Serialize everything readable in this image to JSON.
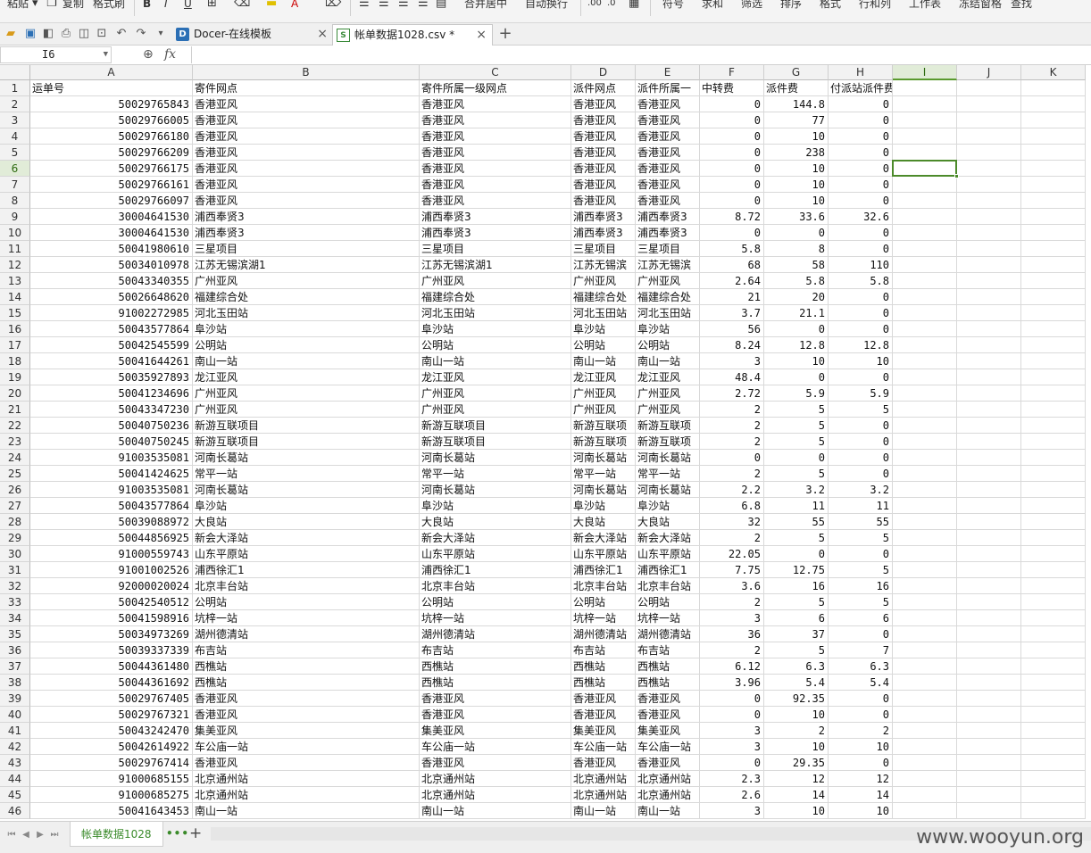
{
  "ribbon": {
    "paste": "粘贴",
    "copy": "复制",
    "format_painter": "格式刷",
    "merge_center": "合并居中",
    "auto_wrap": "自动换行",
    "symbol": "符号",
    "sum": "求和",
    "filter": "筛选",
    "sort": "排序",
    "format": "格式",
    "row_col": "行和列",
    "worksheet": "工作表",
    "freeze": "冻结窗格",
    "find": "查找"
  },
  "tabs": {
    "docer": "Docer-在线模板",
    "docer_icon": "D",
    "csv": "帐单数据1028.csv *",
    "csv_icon": "S"
  },
  "formula": {
    "cell_ref": "I6",
    "fx": "fx",
    "value": ""
  },
  "sheet": {
    "tab": "帐单数据1028",
    "more": "•••",
    "add": "+"
  },
  "watermark": "www.wooyun.org",
  "grid": {
    "columns": [
      "A",
      "B",
      "C",
      "D",
      "E",
      "F",
      "G",
      "H",
      "I",
      "J",
      "K"
    ],
    "selected_column": "I",
    "selected_row": 6,
    "header_row": [
      "运单号",
      "寄件网点",
      "寄件所属一级网点",
      "派件网点",
      "派件所属一",
      "中转费",
      "派件费",
      "付派站派件费"
    ],
    "rows": [
      [
        "50029765843",
        "香港亚风",
        "香港亚风",
        "香港亚风",
        "香港亚风",
        "0",
        "144.8",
        "0"
      ],
      [
        "50029766005",
        "香港亚风",
        "香港亚风",
        "香港亚风",
        "香港亚风",
        "0",
        "77",
        "0"
      ],
      [
        "50029766180",
        "香港亚风",
        "香港亚风",
        "香港亚风",
        "香港亚风",
        "0",
        "10",
        "0"
      ],
      [
        "50029766209",
        "香港亚风",
        "香港亚风",
        "香港亚风",
        "香港亚风",
        "0",
        "238",
        "0"
      ],
      [
        "50029766175",
        "香港亚风",
        "香港亚风",
        "香港亚风",
        "香港亚风",
        "0",
        "10",
        "0"
      ],
      [
        "50029766161",
        "香港亚风",
        "香港亚风",
        "香港亚风",
        "香港亚风",
        "0",
        "10",
        "0"
      ],
      [
        "50029766097",
        "香港亚风",
        "香港亚风",
        "香港亚风",
        "香港亚风",
        "0",
        "10",
        "0"
      ],
      [
        "30004641530",
        "浦西奉贤3",
        "浦西奉贤3",
        "浦西奉贤3",
        "浦西奉贤3",
        "8.72",
        "33.6",
        "32.6"
      ],
      [
        "30004641530",
        "浦西奉贤3",
        "浦西奉贤3",
        "浦西奉贤3",
        "浦西奉贤3",
        "0",
        "0",
        "0"
      ],
      [
        "50041980610",
        "三星项目",
        "三星项目",
        "三星项目",
        "三星项目",
        "5.8",
        "8",
        "0"
      ],
      [
        "50034010978",
        "江苏无锡滨湖1",
        "江苏无锡滨湖1",
        "江苏无锡滨",
        "江苏无锡滨",
        "68",
        "58",
        "110"
      ],
      [
        "50043340355",
        "广州亚风",
        "广州亚风",
        "广州亚风",
        "广州亚风",
        "2.64",
        "5.8",
        "5.8"
      ],
      [
        "50026648620",
        "福建综合处",
        "福建综合处",
        "福建综合处",
        "福建综合处",
        "21",
        "20",
        "0"
      ],
      [
        "91002272985",
        "河北玉田站",
        "河北玉田站",
        "河北玉田站",
        "河北玉田站",
        "3.7",
        "21.1",
        "0"
      ],
      [
        "50043577864",
        "阜沙站",
        "阜沙站",
        "阜沙站",
        "阜沙站",
        "56",
        "0",
        "0"
      ],
      [
        "50042545599",
        "公明站",
        "公明站",
        "公明站",
        "公明站",
        "8.24",
        "12.8",
        "12.8"
      ],
      [
        "50041644261",
        "南山一站",
        "南山一站",
        "南山一站",
        "南山一站",
        "3",
        "10",
        "10"
      ],
      [
        "50035927893",
        "龙江亚风",
        "龙江亚风",
        "龙江亚风",
        "龙江亚风",
        "48.4",
        "0",
        "0"
      ],
      [
        "50041234696",
        "广州亚风",
        "广州亚风",
        "广州亚风",
        "广州亚风",
        "2.72",
        "5.9",
        "5.9"
      ],
      [
        "50043347230",
        "广州亚风",
        "广州亚风",
        "广州亚风",
        "广州亚风",
        "2",
        "5",
        "5"
      ],
      [
        "50040750236",
        "新游互联项目",
        "新游互联项目",
        "新游互联项",
        "新游互联项",
        "2",
        "5",
        "0"
      ],
      [
        "50040750245",
        "新游互联项目",
        "新游互联项目",
        "新游互联项",
        "新游互联项",
        "2",
        "5",
        "0"
      ],
      [
        "91003535081",
        "河南长葛站",
        "河南长葛站",
        "河南长葛站",
        "河南长葛站",
        "0",
        "0",
        "0"
      ],
      [
        "50041424625",
        "常平一站",
        "常平一站",
        "常平一站",
        "常平一站",
        "2",
        "5",
        "0"
      ],
      [
        "91003535081",
        "河南长葛站",
        "河南长葛站",
        "河南长葛站",
        "河南长葛站",
        "2.2",
        "3.2",
        "3.2"
      ],
      [
        "50043577864",
        "阜沙站",
        "阜沙站",
        "阜沙站",
        "阜沙站",
        "6.8",
        "11",
        "11"
      ],
      [
        "50039088972",
        "大良站",
        "大良站",
        "大良站",
        "大良站",
        "32",
        "55",
        "55"
      ],
      [
        "50044856925",
        "新会大泽站",
        "新会大泽站",
        "新会大泽站",
        "新会大泽站",
        "2",
        "5",
        "5"
      ],
      [
        "91000559743",
        "山东平原站",
        "山东平原站",
        "山东平原站",
        "山东平原站",
        "22.05",
        "0",
        "0"
      ],
      [
        "91001002526",
        "浦西徐汇1",
        "浦西徐汇1",
        "浦西徐汇1",
        "浦西徐汇1",
        "7.75",
        "12.75",
        "5"
      ],
      [
        "92000020024",
        "北京丰台站",
        "北京丰台站",
        "北京丰台站",
        "北京丰台站",
        "3.6",
        "16",
        "16"
      ],
      [
        "50042540512",
        "公明站",
        "公明站",
        "公明站",
        "公明站",
        "2",
        "5",
        "5"
      ],
      [
        "50041598916",
        "坑梓一站",
        "坑梓一站",
        "坑梓一站",
        "坑梓一站",
        "3",
        "6",
        "6"
      ],
      [
        "50034973269",
        "湖州德清站",
        "湖州德清站",
        "湖州德清站",
        "湖州德清站",
        "36",
        "37",
        "0"
      ],
      [
        "50039337339",
        "布吉站",
        "布吉站",
        "布吉站",
        "布吉站",
        "2",
        "5",
        "7"
      ],
      [
        "50044361480",
        "西樵站",
        "西樵站",
        "西樵站",
        "西樵站",
        "6.12",
        "6.3",
        "6.3"
      ],
      [
        "50044361692",
        "西樵站",
        "西樵站",
        "西樵站",
        "西樵站",
        "3.96",
        "5.4",
        "5.4"
      ],
      [
        "50029767405",
        "香港亚风",
        "香港亚风",
        "香港亚风",
        "香港亚风",
        "0",
        "92.35",
        "0"
      ],
      [
        "50029767321",
        "香港亚风",
        "香港亚风",
        "香港亚风",
        "香港亚风",
        "0",
        "10",
        "0"
      ],
      [
        "50043242470",
        "集美亚风",
        "集美亚风",
        "集美亚风",
        "集美亚风",
        "3",
        "2",
        "2"
      ],
      [
        "50042614922",
        "车公庙一站",
        "车公庙一站",
        "车公庙一站",
        "车公庙一站",
        "3",
        "10",
        "10"
      ],
      [
        "50029767414",
        "香港亚风",
        "香港亚风",
        "香港亚风",
        "香港亚风",
        "0",
        "29.35",
        "0"
      ],
      [
        "91000685155",
        "北京通州站",
        "北京通州站",
        "北京通州站",
        "北京通州站",
        "2.3",
        "12",
        "12"
      ],
      [
        "91000685275",
        "北京通州站",
        "北京通州站",
        "北京通州站",
        "北京通州站",
        "2.6",
        "14",
        "14"
      ],
      [
        "50041643453",
        "南山一站",
        "南山一站",
        "南山一站",
        "南山一站",
        "3",
        "10",
        "10"
      ]
    ]
  }
}
